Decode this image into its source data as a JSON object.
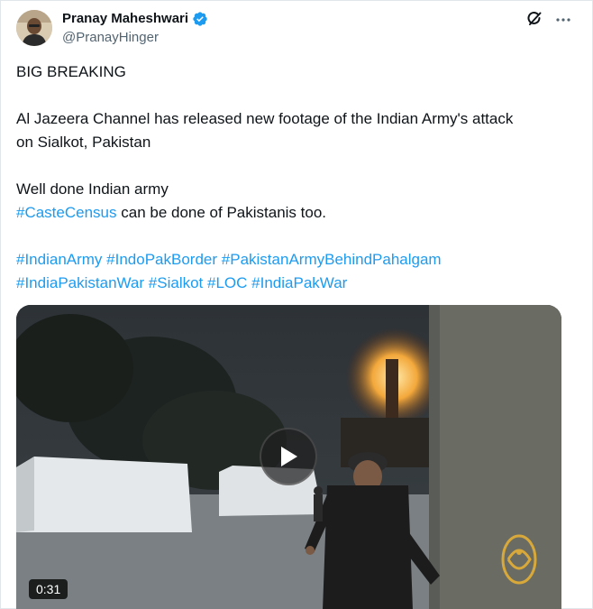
{
  "author": {
    "display_name": "Pranay Maheshwari",
    "handle": "@PranayHinger",
    "verified_icon": "verified-badge-icon"
  },
  "actions": {
    "grok_icon": "grok-icon",
    "more_icon": "more-icon",
    "more_glyph": "···"
  },
  "tweet": {
    "line1": "BIG BREAKING",
    "line2": "Al Jazeera Channel has released new footage of the Indian Army's attack",
    "line3": "on Sialkot, Pakistan",
    "line4": "Well done Indian army",
    "line5_tag": "#CasteCensus",
    "line5_rest": " can be done of Pakistanis too.",
    "hashtags_row1": [
      "#IndianArmy",
      "#IndoPakBorder",
      "#PakistanArmyBehindPahalgam"
    ],
    "hashtags_row2": [
      "#IndiaPakistanWar",
      "#Sialkot",
      "#LOC",
      "#IndiaPakWar"
    ]
  },
  "video": {
    "duration": "0:31",
    "play_icon": "play-icon",
    "watermark": "Al Jazeera logo"
  },
  "colors": {
    "link": "#1d9bf0",
    "text": "#0f1419",
    "secondary": "#536471",
    "verified": "#1d9bf0"
  }
}
